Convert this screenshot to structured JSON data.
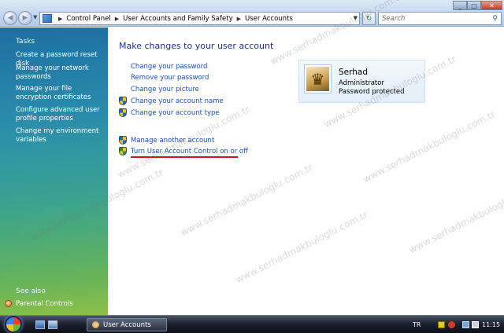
{
  "window": {
    "breadcrumbs": [
      "Control Panel",
      "User Accounts and Family Safety",
      "User Accounts"
    ],
    "search_placeholder": "Search"
  },
  "taskpane": {
    "tasks_heading": "Tasks",
    "tasks": [
      "Create a password reset disk",
      "Manage your network passwords",
      "Manage your file encryption certificates",
      "Configure advanced user profile properties",
      "Change my environment variables"
    ],
    "see_also_heading": "See also",
    "see_also": [
      "Parental Controls"
    ]
  },
  "main": {
    "title": "Make changes to your user account",
    "links": [
      "Change your password",
      "Remove your password",
      "Change your picture",
      "Change your account name",
      "Change your account type"
    ],
    "other_links": [
      "Manage another account",
      "Turn User Account Control on or off"
    ]
  },
  "account": {
    "name": "Serhad",
    "role": "Administrator",
    "status": "Password protected"
  },
  "watermark": "www.serhadmakbuloglu.com.tr",
  "taskbar": {
    "task_button": "User Accounts",
    "language": "TR",
    "clock": "11:15"
  },
  "colors": {
    "link": "#1b4fb3",
    "title": "#1e3287",
    "highlight_underline": "#d4121a"
  },
  "icons": [
    "back-arrow-icon",
    "forward-arrow-icon",
    "control-panel-icon",
    "refresh-icon",
    "search-icon",
    "uac-shield-icon",
    "parental-controls-icon",
    "user-avatar",
    "windows-start-icon"
  ]
}
